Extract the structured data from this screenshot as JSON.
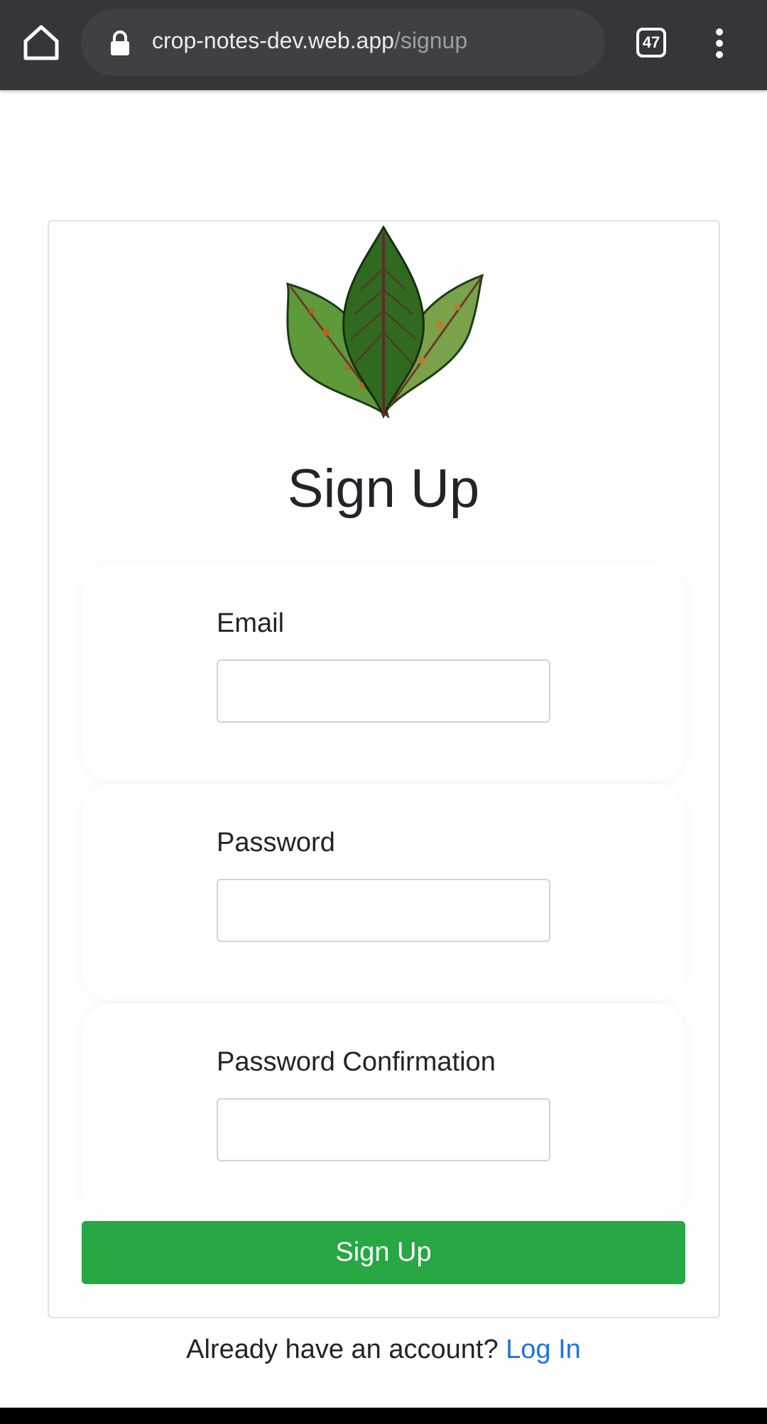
{
  "browser": {
    "url_host": "crop-notes-dev.web.app",
    "url_path": "/signup",
    "tab_count": "47"
  },
  "page": {
    "title": "Sign Up",
    "fields": [
      {
        "label": "Email",
        "value": ""
      },
      {
        "label": "Password",
        "value": ""
      },
      {
        "label": "Password Confirmation",
        "value": ""
      }
    ],
    "submit_label": "Sign Up",
    "footer_text": "Already have an account?",
    "footer_link": "Log In"
  },
  "colors": {
    "toolbar": "#35363a",
    "submit_bg": "#28a745",
    "link": "#1a73e8"
  },
  "icons": [
    "home-icon",
    "lock-icon",
    "tab-count-icon",
    "more-vert-icon",
    "leaves-logo"
  ]
}
